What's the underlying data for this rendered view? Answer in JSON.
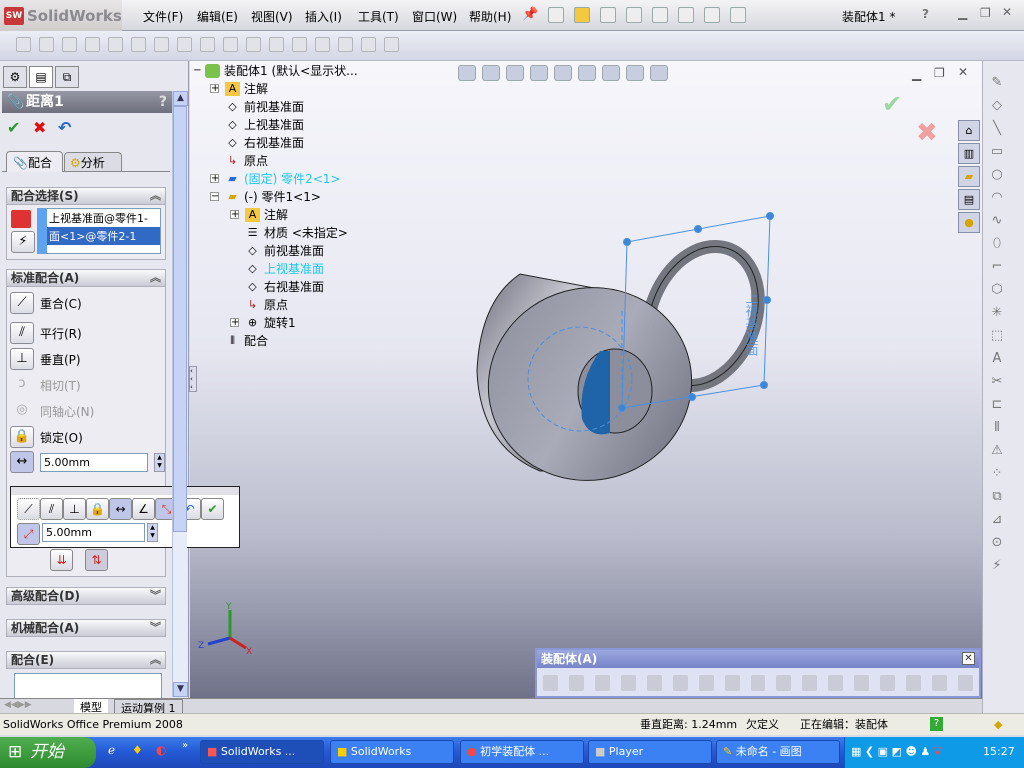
{
  "app": {
    "name": "SolidWorks",
    "doc_title": "装配体1 *"
  },
  "menu": [
    "文件(F)",
    "编辑(E)",
    "视图(V)",
    "插入(I)",
    "工具(T)",
    "窗口(W)",
    "帮助(H)"
  ],
  "property_manager": {
    "title": "距离1",
    "help": "?",
    "tabs": [
      "配合",
      "分析"
    ],
    "mate_selection": {
      "header": "配合选择(S)",
      "items": [
        "上视基准面@零件1-",
        "面<1>@零件2-1"
      ]
    },
    "standard_mates": {
      "header": "标准配合(A)",
      "items": [
        {
          "label": "重合(C)",
          "icon": "coincident-icon",
          "enabled": true
        },
        {
          "label": "平行(R)",
          "icon": "parallel-icon",
          "enabled": true
        },
        {
          "label": "垂直(P)",
          "icon": "perpendicular-icon",
          "enabled": true
        },
        {
          "label": "相切(T)",
          "icon": "tangent-icon",
          "enabled": false
        },
        {
          "label": "同轴心(N)",
          "icon": "concentric-icon",
          "enabled": false
        },
        {
          "label": "锁定(O)",
          "icon": "lock-icon",
          "enabled": true
        }
      ],
      "distance_value": "5.00mm"
    },
    "advanced_mates": "高级配合(D)",
    "mechanical_mates": "机械配合(A)",
    "mates": "配合(E)"
  },
  "popup_toolbar": {
    "distance_value": "5.00mm"
  },
  "bottom_tabs": [
    "模型",
    "运动算例 1"
  ],
  "tree": {
    "root": "装配体1  (默认<显示状...",
    "items": [
      {
        "label": "注解",
        "level": 1,
        "icon": "annotation-icon",
        "expand": true
      },
      {
        "label": "前视基准面",
        "level": 1,
        "icon": "plane-icon"
      },
      {
        "label": "上视基准面",
        "level": 1,
        "icon": "plane-icon"
      },
      {
        "label": "右视基准面",
        "level": 1,
        "icon": "plane-icon"
      },
      {
        "label": "原点",
        "level": 1,
        "icon": "origin-icon"
      },
      {
        "label": "(固定) 零件2<1>",
        "level": 1,
        "icon": "part-icon",
        "expand": true,
        "highlight": true
      },
      {
        "label": "(-) 零件1<1>",
        "level": 1,
        "icon": "part-icon",
        "collapse": true
      },
      {
        "label": "注解",
        "level": 2,
        "icon": "annotation-icon",
        "expand": true
      },
      {
        "label": "材质 <未指定>",
        "level": 2,
        "icon": "material-icon"
      },
      {
        "label": "前视基准面",
        "level": 2,
        "icon": "plane-icon"
      },
      {
        "label": "上视基准面",
        "level": 2,
        "icon": "plane-icon",
        "highlight": true
      },
      {
        "label": "右视基准面",
        "level": 2,
        "icon": "plane-icon"
      },
      {
        "label": "原点",
        "level": 2,
        "icon": "origin-icon"
      },
      {
        "label": "旋转1",
        "level": 2,
        "icon": "revolve-icon",
        "expand": true
      },
      {
        "label": "配合",
        "level": 1,
        "icon": "mates-icon"
      }
    ]
  },
  "viewport": {
    "plane_label": "上视基准面",
    "triad": {
      "x": "X",
      "y": "Y",
      "z": "Z"
    }
  },
  "assembly_toolbar": {
    "title": "装配体(A)"
  },
  "status": {
    "product": "SolidWorks Office Premium 2008",
    "distance": "垂直距离: 1.24mm",
    "state": "欠定义",
    "editing": "正在编辑：装配体",
    "help": "?"
  },
  "taskbar": {
    "start": "开始",
    "tasks": [
      "SolidWorks ...",
      "SolidWorks",
      "初学装配体 ...",
      "Player",
      "未命名 - 画图"
    ],
    "clock": "15:27"
  },
  "colors": {
    "accent": "#2458d4",
    "highlight": "#22c8e8",
    "selection": "#3a7fd0"
  }
}
